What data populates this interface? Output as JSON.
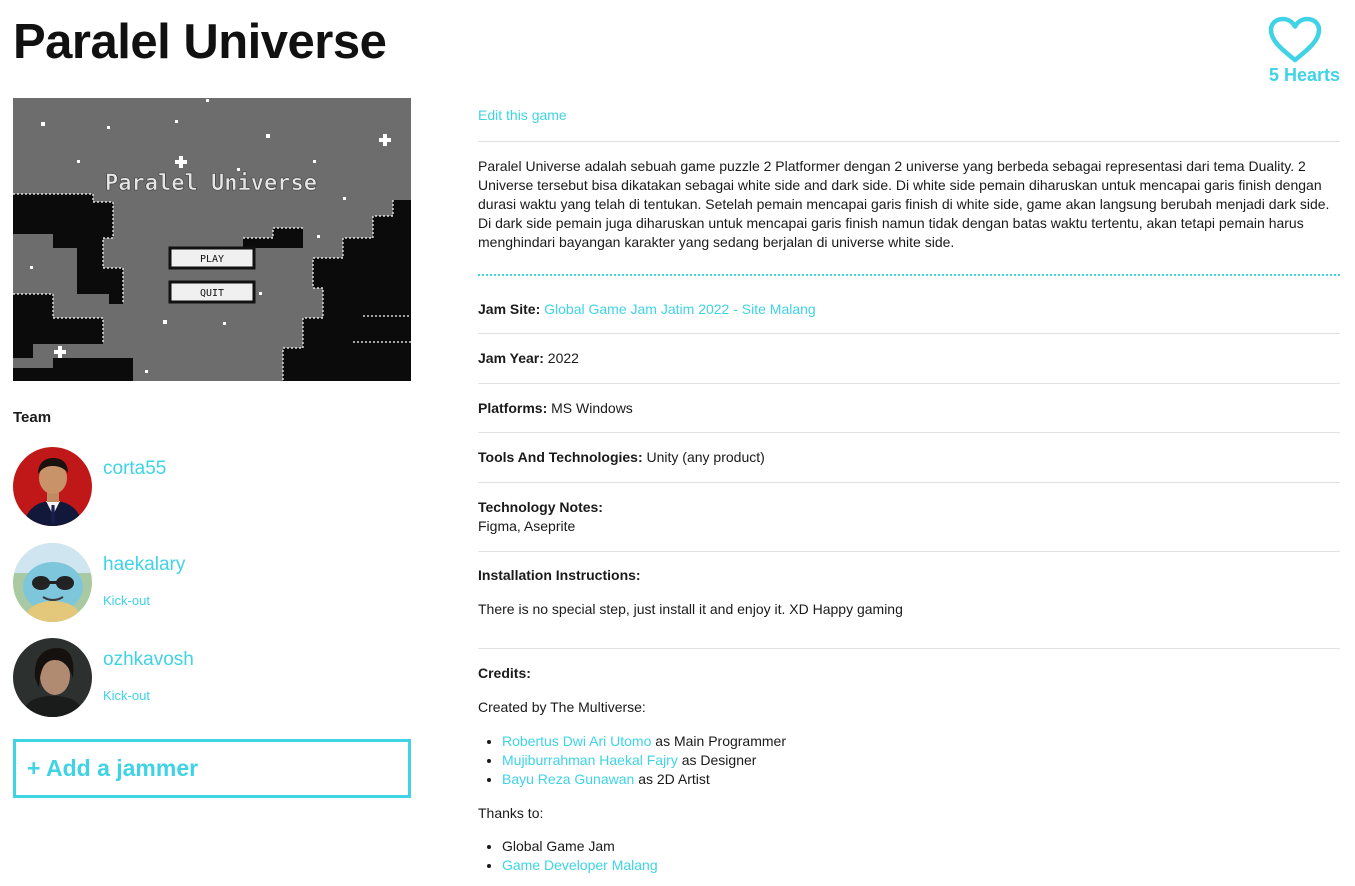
{
  "game": {
    "title": "Paralel Universe",
    "hearts_label": "5 Hearts",
    "screenshot": {
      "title_text": "Paralel Universe",
      "play_label": "PLAY",
      "quit_label": "QUIT"
    }
  },
  "team": {
    "label": "Team",
    "members": [
      {
        "name": "corta55",
        "kick_label": ""
      },
      {
        "name": "haekalary",
        "kick_label": "Kick-out"
      },
      {
        "name": "ozhkavosh",
        "kick_label": "Kick-out"
      }
    ],
    "add_label": "+ Add a jammer"
  },
  "details": {
    "edit_label": "Edit this game",
    "description": "Paralel Universe adalah sebuah game puzzle 2 Platformer dengan 2 universe yang berbeda sebagai representasi dari tema Duality. 2 Universe tersebut bisa dikatakan sebagai white side and dark side. Di white side pemain diharuskan untuk mencapai garis finish dengan durasi waktu yang telah di tentukan. Setelah pemain mencapai garis finish di white side, game akan langsung berubah menjadi dark side. Di dark side pemain juga diharuskan untuk mencapai garis finish namun tidak dengan batas waktu tertentu, akan tetapi pemain harus menghindari bayangan karakter yang sedang berjalan di universe white side.",
    "jam_site": {
      "label": "Jam Site:",
      "value": "Global Game Jam Jatim 2022 - Site Malang"
    },
    "jam_year": {
      "label": "Jam Year:",
      "value": "2022"
    },
    "platforms": {
      "label": "Platforms:",
      "value": "MS Windows"
    },
    "tools": {
      "label": "Tools And Technologies:",
      "value": "Unity (any product)"
    },
    "tech_notes": {
      "label": "Technology Notes:",
      "value": "Figma, Aseprite"
    },
    "install": {
      "label": "Installation Instructions:",
      "value": "There is no special step, just install it and enjoy it. XD Happy gaming"
    },
    "credits": {
      "label": "Credits:",
      "created_by": "Created by The Multiverse:",
      "people": [
        {
          "name": "Robertus Dwi Ari Utomo",
          "role": "as Main Programmer"
        },
        {
          "name": "Mujiburrahman Haekal Fajry",
          "role": "as Designer"
        },
        {
          "name": "Bayu Reza Gunawan",
          "role": "as 2D Artist"
        }
      ],
      "thanks_label": "Thanks to:",
      "thanks": [
        {
          "name": "Global Game Jam"
        },
        {
          "name": "Game Developer Malang"
        }
      ]
    }
  },
  "colors": {
    "accent": "#3fd3e5",
    "text": "#1a1a1a"
  }
}
